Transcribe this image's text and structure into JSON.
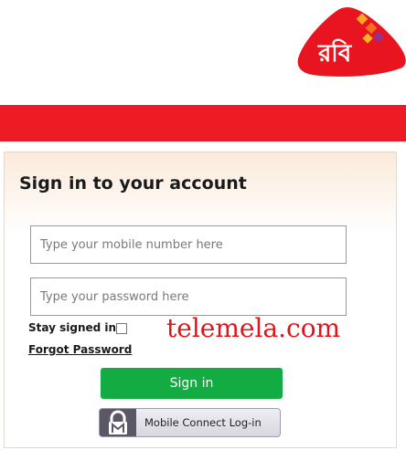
{
  "brand": {
    "logo_text": "রবি",
    "primary_color": "#ed1c24"
  },
  "login": {
    "heading": "Sign in to your account",
    "mobile_placeholder": "Type your mobile number here",
    "mobile_value": "",
    "password_placeholder": "Type your password here",
    "password_value": "",
    "stay_signed_in_label": "Stay signed in",
    "stay_signed_in_checked": false,
    "forgot_password_label": "Forgot Password",
    "signin_label": "Sign in",
    "mobile_connect_label": "Mobile Connect Log-in"
  },
  "watermark": {
    "text": "telemela.com"
  },
  "icons": {
    "mobile_connect": "padlock-icon",
    "logo": "robi-logo-icon"
  },
  "colors": {
    "signin_button": "#13ac42",
    "watermark": "#e0141b"
  }
}
